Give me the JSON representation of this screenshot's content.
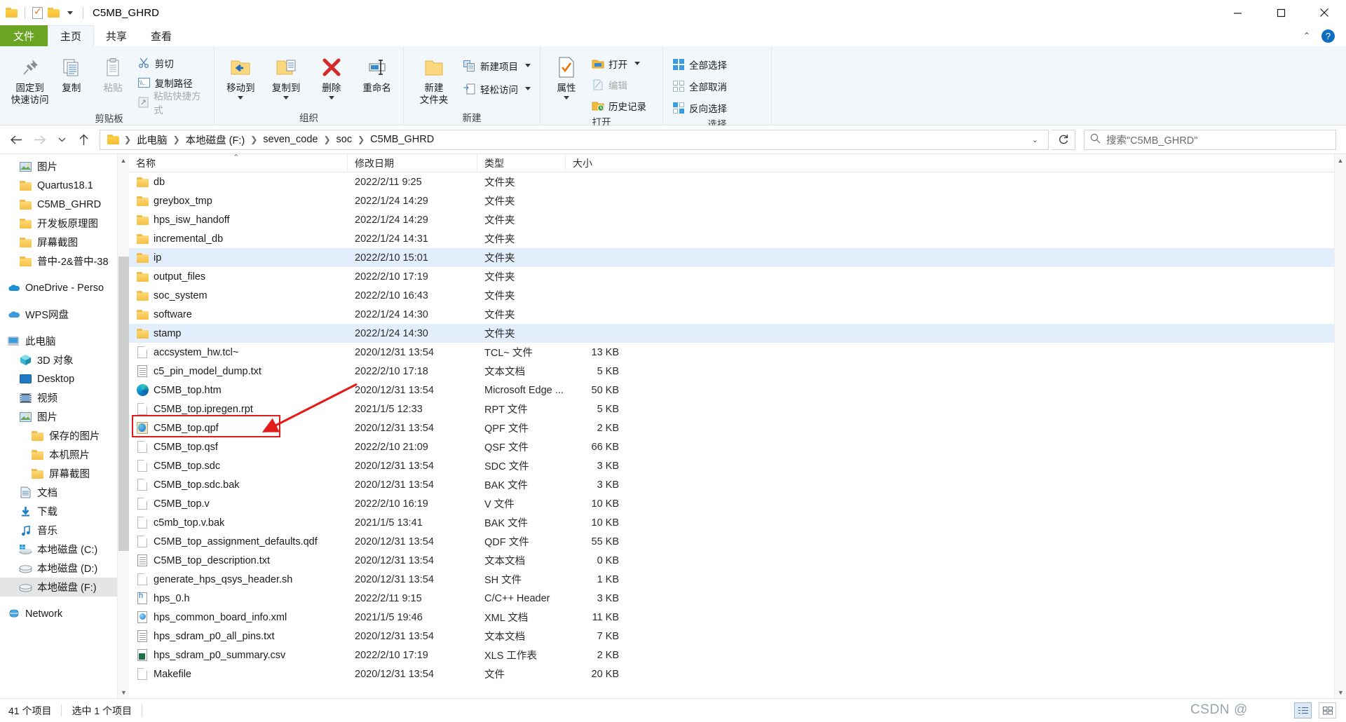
{
  "window": {
    "title": "C5MB_GHRD",
    "quick_access": [
      "folder-icon",
      "properties-icon",
      "new-folder-icon"
    ],
    "controls": {
      "minimize": "minimize-icon",
      "maximize": "maximize-icon",
      "close": "close-icon"
    }
  },
  "tabs": [
    {
      "id": "file",
      "label": "文件"
    },
    {
      "id": "home",
      "label": "主页"
    },
    {
      "id": "share",
      "label": "共享"
    },
    {
      "id": "view",
      "label": "查看"
    }
  ],
  "tab_right": {
    "collapse": "chevron-up-icon",
    "help": "?"
  },
  "ribbon": {
    "groups": [
      {
        "name": "clipboard",
        "label": "剪贴板",
        "big": [
          {
            "label": "固定到\n快速访问",
            "line1": "固定到",
            "line2": "快速访问",
            "icon": "pin-icon",
            "disabled": false
          },
          {
            "label": "复制",
            "line1": "复制",
            "line2": "",
            "icon": "copy-icon",
            "disabled": false
          },
          {
            "label": "粘贴",
            "line1": "粘贴",
            "line2": "",
            "icon": "paste-icon",
            "disabled": true
          }
        ],
        "small": [
          {
            "label": "剪切",
            "icon": "scissors-icon",
            "disabled": false
          },
          {
            "label": "复制路径",
            "icon": "copy-path-icon",
            "disabled": false
          },
          {
            "label": "粘贴快捷方式",
            "icon": "paste-shortcut-icon",
            "disabled": true
          }
        ]
      },
      {
        "name": "organize",
        "label": "组织",
        "big": [
          {
            "line1": "移动到",
            "line2": "",
            "icon": "move-to-icon",
            "caret": true
          },
          {
            "line1": "复制到",
            "line2": "",
            "icon": "copy-to-icon",
            "caret": true
          },
          {
            "line1": "删除",
            "line2": "",
            "icon": "delete-icon",
            "caret": true
          },
          {
            "line1": "重命名",
            "line2": "",
            "icon": "rename-icon",
            "caret": false
          }
        ],
        "small": []
      },
      {
        "name": "new",
        "label": "新建",
        "big": [
          {
            "line1": "新建",
            "line2": "文件夹",
            "icon": "new-folder-icon",
            "caret": false
          }
        ],
        "small": [
          {
            "label": "新建项目",
            "icon": "new-item-icon",
            "caret": true
          },
          {
            "label": "轻松访问",
            "icon": "easy-access-icon",
            "caret": true
          }
        ]
      },
      {
        "name": "open",
        "label": "打开",
        "big": [
          {
            "line1": "属性",
            "line2": "",
            "icon": "properties-icon",
            "caret": true
          }
        ],
        "small": [
          {
            "label": "打开",
            "icon": "open-icon",
            "caret": true,
            "disabled": false
          },
          {
            "label": "编辑",
            "icon": "edit-icon",
            "caret": false,
            "disabled": true
          },
          {
            "label": "历史记录",
            "icon": "history-icon",
            "caret": false,
            "disabled": false
          }
        ]
      },
      {
        "name": "select",
        "label": "选择",
        "big": [],
        "small": [
          {
            "label": "全部选择",
            "icon": "select-all-icon"
          },
          {
            "label": "全部取消",
            "icon": "select-none-icon"
          },
          {
            "label": "反向选择",
            "icon": "invert-selection-icon"
          }
        ]
      }
    ]
  },
  "navbar": {
    "back": "back-arrow-icon",
    "forward": "forward-arrow-icon",
    "recent": "chevron-down-icon",
    "up": "up-arrow-icon",
    "breadcrumbs": [
      "此电脑",
      "本地磁盘 (F:)",
      "seven_code",
      "soc",
      "C5MB_GHRD"
    ],
    "refresh": "refresh-icon",
    "search_placeholder": "搜索\"C5MB_GHRD\"",
    "search_value": ""
  },
  "sidebar": {
    "items": [
      {
        "label": "图片",
        "icon": "pictures-icon",
        "indent": 1,
        "pinned": true,
        "selected": false
      },
      {
        "label": "Quartus18.1",
        "icon": "folder-icon",
        "indent": 1,
        "pinned": true,
        "selected": false
      },
      {
        "label": "C5MB_GHRD",
        "icon": "folder-icon",
        "indent": 1,
        "pinned": false,
        "selected": false
      },
      {
        "label": "开发板原理图",
        "icon": "folder-icon",
        "indent": 1,
        "pinned": false,
        "selected": false
      },
      {
        "label": "屏幕截图",
        "icon": "folder-icon",
        "indent": 1,
        "pinned": false,
        "selected": false
      },
      {
        "label": "普中-2&普中-38",
        "icon": "folder-icon",
        "indent": 1,
        "pinned": false,
        "selected": false
      },
      {
        "label": "",
        "icon": "spacer",
        "indent": 0,
        "spacer": true
      },
      {
        "label": "OneDrive - Perso",
        "icon": "onedrive-icon",
        "indent": 0,
        "selected": false
      },
      {
        "label": "",
        "icon": "spacer",
        "indent": 0,
        "spacer": true
      },
      {
        "label": "WPS网盘",
        "icon": "wps-cloud-icon",
        "indent": 0,
        "selected": false
      },
      {
        "label": "",
        "icon": "spacer",
        "indent": 0,
        "spacer": true
      },
      {
        "label": "此电脑",
        "icon": "this-pc-icon",
        "indent": 0,
        "selected": false
      },
      {
        "label": "3D 对象",
        "icon": "3d-objects-icon",
        "indent": 1,
        "selected": false
      },
      {
        "label": "Desktop",
        "icon": "desktop-icon",
        "indent": 1,
        "selected": false
      },
      {
        "label": "视频",
        "icon": "videos-icon",
        "indent": 1,
        "selected": false
      },
      {
        "label": "图片",
        "icon": "pictures-icon",
        "indent": 1,
        "selected": false
      },
      {
        "label": "保存的图片",
        "icon": "folder-icon",
        "indent": 2,
        "selected": false
      },
      {
        "label": "本机照片",
        "icon": "folder-icon",
        "indent": 2,
        "selected": false
      },
      {
        "label": "屏幕截图",
        "icon": "folder-icon",
        "indent": 2,
        "selected": false
      },
      {
        "label": "文档",
        "icon": "documents-icon",
        "indent": 1,
        "selected": false
      },
      {
        "label": "下载",
        "icon": "downloads-icon",
        "indent": 1,
        "selected": false
      },
      {
        "label": "音乐",
        "icon": "music-icon",
        "indent": 1,
        "selected": false
      },
      {
        "label": "本地磁盘 (C:)",
        "icon": "windows-drive-icon",
        "indent": 1,
        "selected": false
      },
      {
        "label": "本地磁盘 (D:)",
        "icon": "drive-icon",
        "indent": 1,
        "selected": false
      },
      {
        "label": "本地磁盘 (F:)",
        "icon": "drive-icon",
        "indent": 1,
        "selected": true
      },
      {
        "label": "",
        "icon": "spacer",
        "indent": 0,
        "spacer": true
      },
      {
        "label": "Network",
        "icon": "network-icon",
        "indent": 0,
        "selected": false
      }
    ]
  },
  "filelist": {
    "columns": [
      {
        "key": "name",
        "label": "名称",
        "sorted": true
      },
      {
        "key": "date",
        "label": "修改日期"
      },
      {
        "key": "type",
        "label": "类型"
      },
      {
        "key": "size",
        "label": "大小"
      }
    ],
    "rows": [
      {
        "name": "db",
        "date": "2022/2/11 9:25",
        "type": "文件夹",
        "size": "",
        "icon": "folder-icon",
        "selected": false
      },
      {
        "name": "greybox_tmp",
        "date": "2022/1/24 14:29",
        "type": "文件夹",
        "size": "",
        "icon": "folder-icon",
        "selected": false
      },
      {
        "name": "hps_isw_handoff",
        "date": "2022/1/24 14:29",
        "type": "文件夹",
        "size": "",
        "icon": "folder-icon",
        "selected": false
      },
      {
        "name": "incremental_db",
        "date": "2022/1/24 14:31",
        "type": "文件夹",
        "size": "",
        "icon": "folder-icon",
        "selected": false
      },
      {
        "name": "ip",
        "date": "2022/2/10 15:01",
        "type": "文件夹",
        "size": "",
        "icon": "folder-icon",
        "selected": true
      },
      {
        "name": "output_files",
        "date": "2022/2/10 17:19",
        "type": "文件夹",
        "size": "",
        "icon": "folder-icon",
        "selected": false
      },
      {
        "name": "soc_system",
        "date": "2022/2/10 16:43",
        "type": "文件夹",
        "size": "",
        "icon": "folder-icon",
        "selected": false
      },
      {
        "name": "software",
        "date": "2022/1/24 14:30",
        "type": "文件夹",
        "size": "",
        "icon": "folder-icon",
        "selected": false
      },
      {
        "name": "stamp",
        "date": "2022/1/24 14:30",
        "type": "文件夹",
        "size": "",
        "icon": "folder-icon",
        "selected": true
      },
      {
        "name": "accsystem_hw.tcl~",
        "date": "2020/12/31 13:54",
        "type": "TCL~ 文件",
        "size": "13 KB",
        "icon": "generic-file-icon",
        "selected": false
      },
      {
        "name": "c5_pin_model_dump.txt",
        "date": "2022/2/10 17:18",
        "type": "文本文档",
        "size": "5 KB",
        "icon": "text-file-icon",
        "selected": false
      },
      {
        "name": "C5MB_top.htm",
        "date": "2020/12/31 13:54",
        "type": "Microsoft Edge ...",
        "size": "50 KB",
        "icon": "edge-icon",
        "selected": false
      },
      {
        "name": "C5MB_top.ipregen.rpt",
        "date": "2021/1/5 12:33",
        "type": "RPT 文件",
        "size": "5 KB",
        "icon": "generic-file-icon",
        "selected": false
      },
      {
        "name": "C5MB_top.qpf",
        "date": "2020/12/31 13:54",
        "type": "QPF 文件",
        "size": "2 KB",
        "icon": "qpf-file-icon",
        "selected": false,
        "annotated": true
      },
      {
        "name": "C5MB_top.qsf",
        "date": "2022/2/10 21:09",
        "type": "QSF 文件",
        "size": "66 KB",
        "icon": "generic-file-icon",
        "selected": false
      },
      {
        "name": "C5MB_top.sdc",
        "date": "2020/12/31 13:54",
        "type": "SDC 文件",
        "size": "3 KB",
        "icon": "generic-file-icon",
        "selected": false
      },
      {
        "name": "C5MB_top.sdc.bak",
        "date": "2020/12/31 13:54",
        "type": "BAK 文件",
        "size": "3 KB",
        "icon": "generic-file-icon",
        "selected": false
      },
      {
        "name": "C5MB_top.v",
        "date": "2022/2/10 16:19",
        "type": "V 文件",
        "size": "10 KB",
        "icon": "generic-file-icon",
        "selected": false
      },
      {
        "name": "c5mb_top.v.bak",
        "date": "2021/1/5 13:41",
        "type": "BAK 文件",
        "size": "10 KB",
        "icon": "generic-file-icon",
        "selected": false
      },
      {
        "name": "C5MB_top_assignment_defaults.qdf",
        "date": "2020/12/31 13:54",
        "type": "QDF 文件",
        "size": "55 KB",
        "icon": "generic-file-icon",
        "selected": false
      },
      {
        "name": "C5MB_top_description.txt",
        "date": "2020/12/31 13:54",
        "type": "文本文档",
        "size": "0 KB",
        "icon": "text-file-icon",
        "selected": false
      },
      {
        "name": "generate_hps_qsys_header.sh",
        "date": "2020/12/31 13:54",
        "type": "SH 文件",
        "size": "1 KB",
        "icon": "generic-file-icon",
        "selected": false
      },
      {
        "name": "hps_0.h",
        "date": "2022/2/11 9:15",
        "type": "C/C++ Header",
        "size": "3 KB",
        "icon": "header-file-icon",
        "selected": false
      },
      {
        "name": "hps_common_board_info.xml",
        "date": "2021/1/5 19:46",
        "type": "XML 文档",
        "size": "11 KB",
        "icon": "xml-file-icon",
        "selected": false
      },
      {
        "name": "hps_sdram_p0_all_pins.txt",
        "date": "2020/12/31 13:54",
        "type": "文本文档",
        "size": "7 KB",
        "icon": "text-file-icon",
        "selected": false
      },
      {
        "name": "hps_sdram_p0_summary.csv",
        "date": "2022/2/10 17:19",
        "type": "XLS 工作表",
        "size": "2 KB",
        "icon": "xls-file-icon",
        "selected": false
      },
      {
        "name": "Makefile",
        "date": "2020/12/31 13:54",
        "type": "文件",
        "size": "20 KB",
        "icon": "generic-file-icon",
        "selected": false
      }
    ]
  },
  "statusbar": {
    "item_count": "41 个项目",
    "selection": "选中 1 个项目",
    "view_details": "details-view-icon",
    "view_tiles": "tiles-view-icon"
  },
  "watermark": "CSDN @",
  "colors": {
    "accent_green": "#6ba524",
    "selection_blue": "#e2eefb",
    "annotation_red": "#e21b1b",
    "ribbon_bg": "#f2f7fb"
  }
}
